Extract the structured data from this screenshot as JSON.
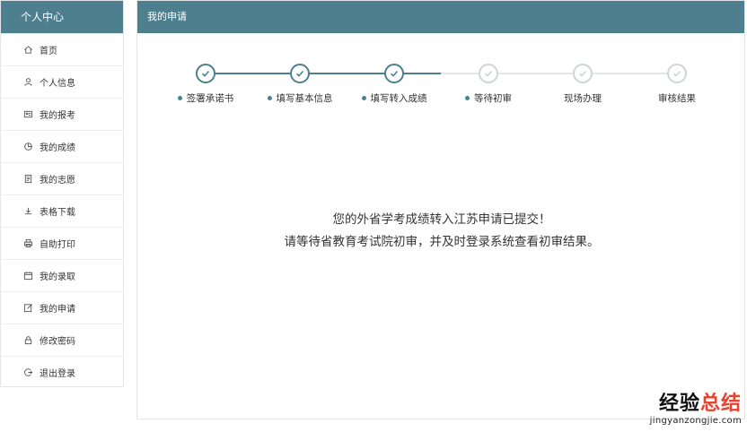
{
  "sidebar": {
    "title": "个人中心",
    "items": [
      {
        "label": "首页",
        "icon": "home-icon"
      },
      {
        "label": "个人信息",
        "icon": "user-icon"
      },
      {
        "label": "我的报考",
        "icon": "id-card-icon"
      },
      {
        "label": "我的成绩",
        "icon": "pie-chart-icon"
      },
      {
        "label": "我的志愿",
        "icon": "document-icon"
      },
      {
        "label": "表格下载",
        "icon": "download-icon"
      },
      {
        "label": "自助打印",
        "icon": "printer-icon"
      },
      {
        "label": "我的录取",
        "icon": "calendar-icon"
      },
      {
        "label": "我的申请",
        "icon": "edit-icon"
      },
      {
        "label": "修改密码",
        "icon": "lock-icon"
      },
      {
        "label": "退出登录",
        "icon": "logout-icon"
      }
    ]
  },
  "panel": {
    "title": "我的申请"
  },
  "steps": [
    {
      "label": "签署承诺书",
      "status": "done"
    },
    {
      "label": "填写基本信息",
      "status": "done"
    },
    {
      "label": "填写转入成绩",
      "status": "done"
    },
    {
      "label": "等待初审",
      "status": "current"
    },
    {
      "label": "现场办理",
      "status": "pending"
    },
    {
      "label": "审核结果",
      "status": "pending"
    }
  ],
  "message": {
    "line1": "您的外省学考成绩转入江苏申请已提交！",
    "line2": "请等待省教育考试院初审，并及时登录系统查看初审结果。"
  },
  "watermark": {
    "main_a": "经验",
    "main_b": "总结",
    "sub": "jingyanzongjie.com"
  },
  "colors": {
    "accent": "#4d7f8f",
    "pending": "#cfd4d6",
    "watermark_red": "#e8432e"
  }
}
